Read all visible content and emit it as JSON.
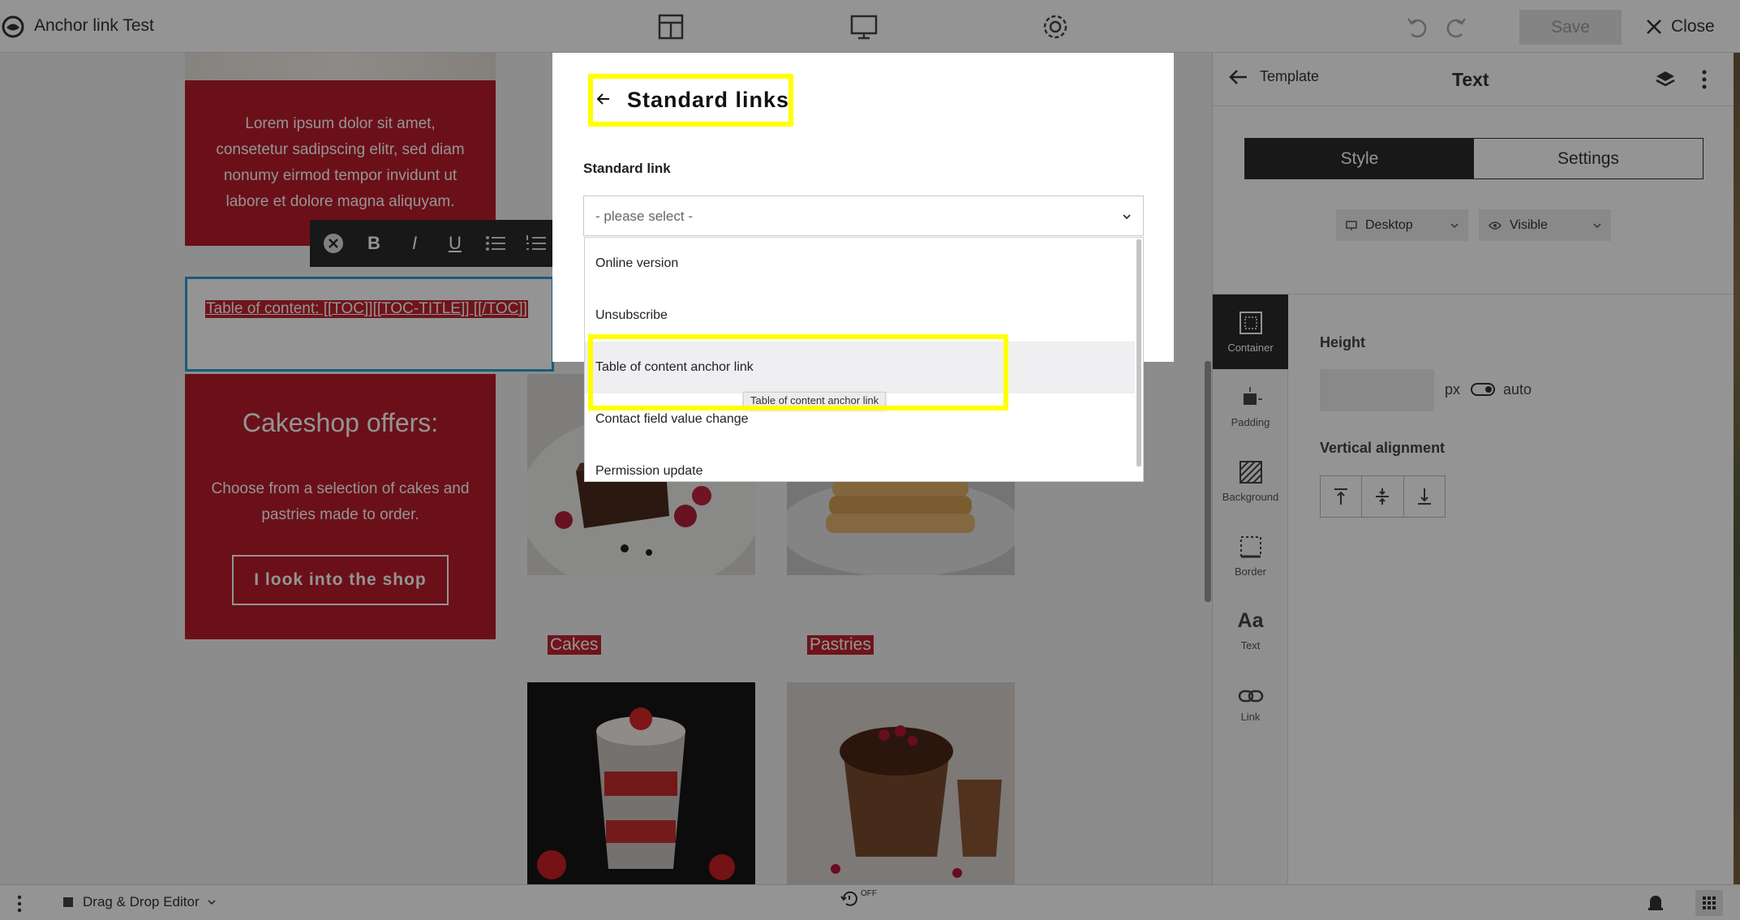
{
  "app": {
    "title": "Anchor link Test"
  },
  "topbar": {
    "icons": [
      "layout-grid-icon",
      "desktop-preview-icon",
      "settings-gear-icon",
      "undo-icon",
      "redo-icon"
    ],
    "save_label": "Save",
    "close_label": "Close"
  },
  "canvas": {
    "lorem": "Lorem ipsum dolor sit amet, consetetur sadipscing elitr, sed diam nonumy eirmod tempor invidunt ut labore et dolore magna aliquyam.",
    "toc_text": "Table of content: [[TOC]][[TOC-TITLE]] [[/TOC]]",
    "format_toolbar": [
      "close",
      "B",
      "I",
      "U",
      "bulleted-list",
      "numbered-list"
    ],
    "offers_title": "Cakeshop offers:",
    "offers_desc": "Choose from a selection of cakes and pastries made to order.",
    "shop_button": "I look into the shop",
    "captions": {
      "cakes": "Cakes",
      "pastries": "Pastries"
    }
  },
  "panel": {
    "back_label": "Template",
    "title": "Text",
    "tabs": {
      "style": "Style",
      "settings": "Settings"
    },
    "device": "Desktop",
    "visibility": "Visible",
    "rail": [
      {
        "label": "Container",
        "icon": "container-icon"
      },
      {
        "label": "Padding",
        "icon": "padding-icon"
      },
      {
        "label": "Background",
        "icon": "background-icon"
      },
      {
        "label": "Border",
        "icon": "border-icon"
      },
      {
        "label": "Text",
        "icon": "text-icon",
        "glyph": "Aa"
      },
      {
        "label": "Link",
        "icon": "link-icon"
      }
    ],
    "height_label": "Height",
    "height_value": "",
    "px_label": "px",
    "auto_label": "auto",
    "valign_label": "Vertical alignment"
  },
  "bottombar": {
    "editor_label": "Drag & Drop Editor",
    "autosave_state": "OFF"
  },
  "modal": {
    "title": "Standard links",
    "field_label": "Standard link",
    "placeholder": "- please select -",
    "options": [
      "Online version",
      "Unsubscribe",
      "Table of content anchor link",
      "Contact field value change",
      "Permission update"
    ],
    "highlighted_option": "Table of content anchor link",
    "tooltip": "Table of content anchor link"
  },
  "colors": {
    "brand_red": "#b81d2a",
    "highlight_yellow": "#ffff00",
    "selection_blue": "#2a9fd6",
    "dark": "#2a2a2a"
  }
}
